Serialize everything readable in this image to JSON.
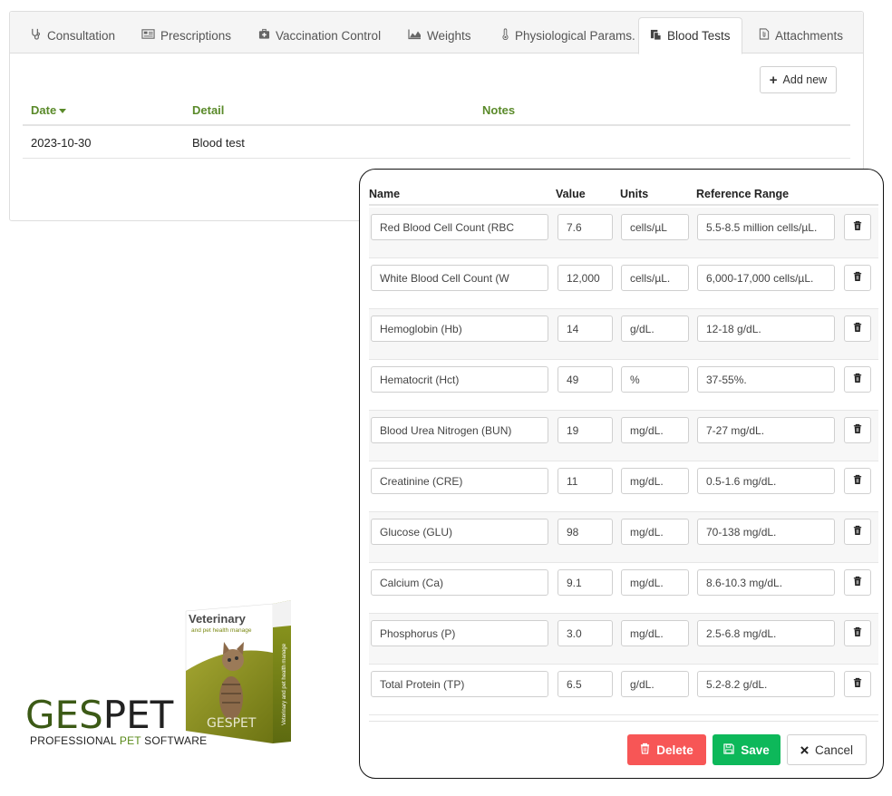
{
  "tabs": [
    {
      "label": "Consultation",
      "icon": "stethoscope-icon",
      "active": false
    },
    {
      "label": "Prescriptions",
      "icon": "prescription-card-icon",
      "active": false
    },
    {
      "label": "Vaccination Control",
      "icon": "medical-kit-icon",
      "active": false
    },
    {
      "label": "Weights",
      "icon": "area-chart-icon",
      "active": false
    },
    {
      "label": "Physiological Params.",
      "icon": "thermometer-icon",
      "active": false
    },
    {
      "label": "Blood Tests",
      "icon": "copy-documents-icon",
      "active": true
    },
    {
      "label": "Attachments",
      "icon": "file-attachment-icon",
      "active": false
    }
  ],
  "toolbar": {
    "add_new_label": "Add new"
  },
  "list": {
    "columns": [
      "Date",
      "Detail",
      "Notes"
    ],
    "sort_column": "Date",
    "rows": [
      {
        "date": "2023-10-30",
        "detail": "Blood test",
        "notes": ""
      }
    ]
  },
  "modal": {
    "columns": [
      "Name",
      "Value",
      "Units",
      "Reference Range"
    ],
    "rows": [
      {
        "name": "Red Blood Cell Count (RBC",
        "value": "7.6",
        "units": "cells/µL",
        "range": "5.5-8.5 million cells/µL."
      },
      {
        "name": "White Blood Cell Count (W",
        "value": "12,000",
        "units": "cells/µL.",
        "range": "6,000-17,000 cells/µL."
      },
      {
        "name": "Hemoglobin (Hb)",
        "value": "14",
        "units": "g/dL.",
        "range": "12-18 g/dL."
      },
      {
        "name": "Hematocrit (Hct)",
        "value": "49",
        "units": "%",
        "range": "37-55%."
      },
      {
        "name": "Blood Urea Nitrogen (BUN)",
        "value": "19",
        "units": "mg/dL.",
        "range": "7-27 mg/dL."
      },
      {
        "name": "Creatinine (CRE)",
        "value": "11",
        "units": "mg/dL.",
        "range": "0.5-1.6 mg/dL."
      },
      {
        "name": "Glucose (GLU)",
        "value": "98",
        "units": "mg/dL.",
        "range": "70-138 mg/dL."
      },
      {
        "name": "Calcium (Ca)",
        "value": "9.1",
        "units": "mg/dL.",
        "range": "8.6-10.3 mg/dL."
      },
      {
        "name": "Phosphorus (P)",
        "value": "3.0",
        "units": "mg/dL.",
        "range": "2.5-6.8 mg/dL."
      },
      {
        "name": "Total Protein (TP)",
        "value": "6.5",
        "units": "g/dL.",
        "range": "5.2-8.2 g/dL."
      }
    ],
    "buttons": {
      "delete": "Delete",
      "save": "Save",
      "cancel": "Cancel"
    }
  },
  "logo": {
    "brand_part1": "GES",
    "brand_part2": "PET",
    "tagline_part1": "PROFESSIONAL ",
    "tagline_part2": "PET",
    "tagline_part3": " SOFTWARE",
    "box_title": "Veterinary",
    "box_subtitle": "and pet health manage",
    "box_side": "Veterinary and pet health manage",
    "box_brand": "GESPET"
  },
  "colors": {
    "header_green": "#5a8a2a",
    "delete_red": "#f75656",
    "save_green": "#0db85a",
    "logo_green": "#3c5a16"
  }
}
